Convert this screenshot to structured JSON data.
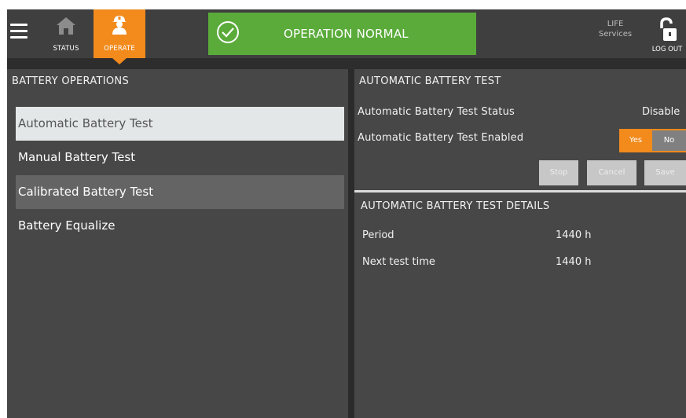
{
  "header": {
    "tabs": {
      "status": "STATUS",
      "operate": "OPERATE"
    },
    "status_banner": "OPERATION NORMAL",
    "life_line1": "LIFE",
    "life_line2": "Services",
    "logout": "LOG OUT"
  },
  "left": {
    "title": "BATTERY OPERATIONS",
    "items": [
      "Automatic Battery Test",
      "Manual Battery Test",
      "Calibrated Battery Test",
      "Battery Equalize"
    ]
  },
  "right": {
    "title": "AUTOMATIC BATTERY TEST",
    "status_label": "Automatic Battery Test Status",
    "status_value": "Disable",
    "enabled_label": "Automatic Battery Test Enabled",
    "toggle": {
      "yes": "Yes",
      "no": "No",
      "selected": "Yes"
    },
    "buttons": {
      "stop": "Stop",
      "cancel": "Cancel",
      "save": "Save"
    },
    "details_title": "AUTOMATIC BATTERY TEST DETAILS",
    "details": [
      {
        "label": "Period",
        "value": "1440 h"
      },
      {
        "label": "Next test time",
        "value": "1440 h"
      }
    ]
  },
  "colors": {
    "accent": "#f28a1c",
    "ok_green": "#5aab3a",
    "panel": "#474747"
  }
}
